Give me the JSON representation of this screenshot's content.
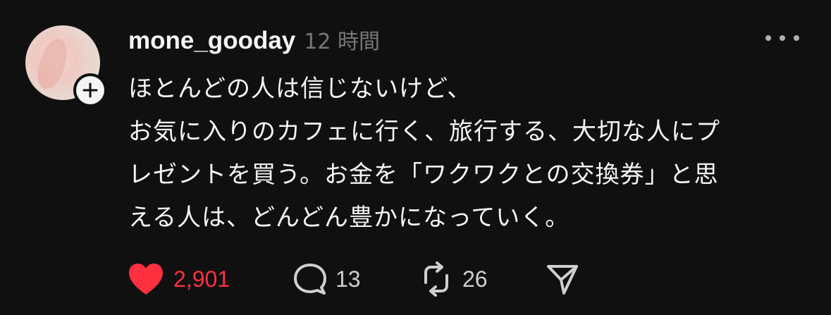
{
  "post": {
    "username": "mone_gooday",
    "timestamp": "12 時間",
    "lines": [
      "ほとんどの人は信じないけど、",
      "お気に入りのカフェに行く、旅行する、大切な人にプ",
      "レゼントを買う。お金を「ワクワクとの交換券」と思",
      "える人は、どんどん豊かになっていく。"
    ]
  },
  "actions": {
    "likes": "2,901",
    "comments": "13",
    "reposts": "26"
  },
  "colors": {
    "background": "#101010",
    "text": "#f3f5f7",
    "muted": "#777777",
    "like": "#ff3040"
  },
  "icons": {
    "like": "heart-icon",
    "comment": "comment-bubble-icon",
    "repost": "repost-icon",
    "share": "send-icon",
    "follow": "plus-icon",
    "more": "more-dots-icon"
  }
}
